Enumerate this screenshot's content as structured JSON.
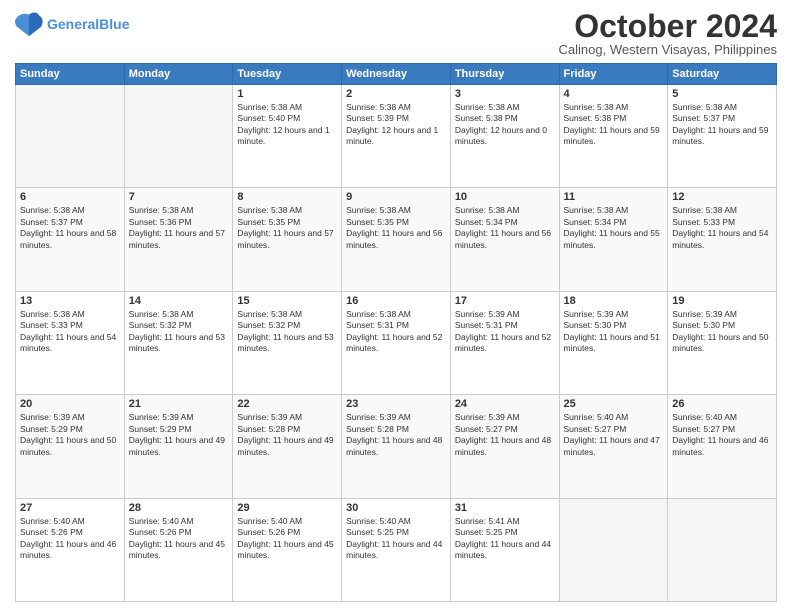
{
  "logo": {
    "line1": "General",
    "line2": "Blue"
  },
  "header": {
    "month": "October 2024",
    "location": "Calinog, Western Visayas, Philippines"
  },
  "days_of_week": [
    "Sunday",
    "Monday",
    "Tuesday",
    "Wednesday",
    "Thursday",
    "Friday",
    "Saturday"
  ],
  "weeks": [
    [
      {
        "day": "",
        "empty": true
      },
      {
        "day": "",
        "empty": true
      },
      {
        "day": "1",
        "sunrise": "Sunrise: 5:38 AM",
        "sunset": "Sunset: 5:40 PM",
        "daylight": "Daylight: 12 hours and 1 minute."
      },
      {
        "day": "2",
        "sunrise": "Sunrise: 5:38 AM",
        "sunset": "Sunset: 5:39 PM",
        "daylight": "Daylight: 12 hours and 1 minute."
      },
      {
        "day": "3",
        "sunrise": "Sunrise: 5:38 AM",
        "sunset": "Sunset: 5:38 PM",
        "daylight": "Daylight: 12 hours and 0 minutes."
      },
      {
        "day": "4",
        "sunrise": "Sunrise: 5:38 AM",
        "sunset": "Sunset: 5:38 PM",
        "daylight": "Daylight: 11 hours and 59 minutes."
      },
      {
        "day": "5",
        "sunrise": "Sunrise: 5:38 AM",
        "sunset": "Sunset: 5:37 PM",
        "daylight": "Daylight: 11 hours and 59 minutes."
      }
    ],
    [
      {
        "day": "6",
        "sunrise": "Sunrise: 5:38 AM",
        "sunset": "Sunset: 5:37 PM",
        "daylight": "Daylight: 11 hours and 58 minutes."
      },
      {
        "day": "7",
        "sunrise": "Sunrise: 5:38 AM",
        "sunset": "Sunset: 5:36 PM",
        "daylight": "Daylight: 11 hours and 57 minutes."
      },
      {
        "day": "8",
        "sunrise": "Sunrise: 5:38 AM",
        "sunset": "Sunset: 5:35 PM",
        "daylight": "Daylight: 11 hours and 57 minutes."
      },
      {
        "day": "9",
        "sunrise": "Sunrise: 5:38 AM",
        "sunset": "Sunset: 5:35 PM",
        "daylight": "Daylight: 11 hours and 56 minutes."
      },
      {
        "day": "10",
        "sunrise": "Sunrise: 5:38 AM",
        "sunset": "Sunset: 5:34 PM",
        "daylight": "Daylight: 11 hours and 56 minutes."
      },
      {
        "day": "11",
        "sunrise": "Sunrise: 5:38 AM",
        "sunset": "Sunset: 5:34 PM",
        "daylight": "Daylight: 11 hours and 55 minutes."
      },
      {
        "day": "12",
        "sunrise": "Sunrise: 5:38 AM",
        "sunset": "Sunset: 5:33 PM",
        "daylight": "Daylight: 11 hours and 54 minutes."
      }
    ],
    [
      {
        "day": "13",
        "sunrise": "Sunrise: 5:38 AM",
        "sunset": "Sunset: 5:33 PM",
        "daylight": "Daylight: 11 hours and 54 minutes."
      },
      {
        "day": "14",
        "sunrise": "Sunrise: 5:38 AM",
        "sunset": "Sunset: 5:32 PM",
        "daylight": "Daylight: 11 hours and 53 minutes."
      },
      {
        "day": "15",
        "sunrise": "Sunrise: 5:38 AM",
        "sunset": "Sunset: 5:32 PM",
        "daylight": "Daylight: 11 hours and 53 minutes."
      },
      {
        "day": "16",
        "sunrise": "Sunrise: 5:38 AM",
        "sunset": "Sunset: 5:31 PM",
        "daylight": "Daylight: 11 hours and 52 minutes."
      },
      {
        "day": "17",
        "sunrise": "Sunrise: 5:39 AM",
        "sunset": "Sunset: 5:31 PM",
        "daylight": "Daylight: 11 hours and 52 minutes."
      },
      {
        "day": "18",
        "sunrise": "Sunrise: 5:39 AM",
        "sunset": "Sunset: 5:30 PM",
        "daylight": "Daylight: 11 hours and 51 minutes."
      },
      {
        "day": "19",
        "sunrise": "Sunrise: 5:39 AM",
        "sunset": "Sunset: 5:30 PM",
        "daylight": "Daylight: 11 hours and 50 minutes."
      }
    ],
    [
      {
        "day": "20",
        "sunrise": "Sunrise: 5:39 AM",
        "sunset": "Sunset: 5:29 PM",
        "daylight": "Daylight: 11 hours and 50 minutes."
      },
      {
        "day": "21",
        "sunrise": "Sunrise: 5:39 AM",
        "sunset": "Sunset: 5:29 PM",
        "daylight": "Daylight: 11 hours and 49 minutes."
      },
      {
        "day": "22",
        "sunrise": "Sunrise: 5:39 AM",
        "sunset": "Sunset: 5:28 PM",
        "daylight": "Daylight: 11 hours and 49 minutes."
      },
      {
        "day": "23",
        "sunrise": "Sunrise: 5:39 AM",
        "sunset": "Sunset: 5:28 PM",
        "daylight": "Daylight: 11 hours and 48 minutes."
      },
      {
        "day": "24",
        "sunrise": "Sunrise: 5:39 AM",
        "sunset": "Sunset: 5:27 PM",
        "daylight": "Daylight: 11 hours and 48 minutes."
      },
      {
        "day": "25",
        "sunrise": "Sunrise: 5:40 AM",
        "sunset": "Sunset: 5:27 PM",
        "daylight": "Daylight: 11 hours and 47 minutes."
      },
      {
        "day": "26",
        "sunrise": "Sunrise: 5:40 AM",
        "sunset": "Sunset: 5:27 PM",
        "daylight": "Daylight: 11 hours and 46 minutes."
      }
    ],
    [
      {
        "day": "27",
        "sunrise": "Sunrise: 5:40 AM",
        "sunset": "Sunset: 5:26 PM",
        "daylight": "Daylight: 11 hours and 46 minutes."
      },
      {
        "day": "28",
        "sunrise": "Sunrise: 5:40 AM",
        "sunset": "Sunset: 5:26 PM",
        "daylight": "Daylight: 11 hours and 45 minutes."
      },
      {
        "day": "29",
        "sunrise": "Sunrise: 5:40 AM",
        "sunset": "Sunset: 5:26 PM",
        "daylight": "Daylight: 11 hours and 45 minutes."
      },
      {
        "day": "30",
        "sunrise": "Sunrise: 5:40 AM",
        "sunset": "Sunset: 5:25 PM",
        "daylight": "Daylight: 11 hours and 44 minutes."
      },
      {
        "day": "31",
        "sunrise": "Sunrise: 5:41 AM",
        "sunset": "Sunset: 5:25 PM",
        "daylight": "Daylight: 11 hours and 44 minutes."
      },
      {
        "day": "",
        "empty": true
      },
      {
        "day": "",
        "empty": true
      }
    ]
  ]
}
